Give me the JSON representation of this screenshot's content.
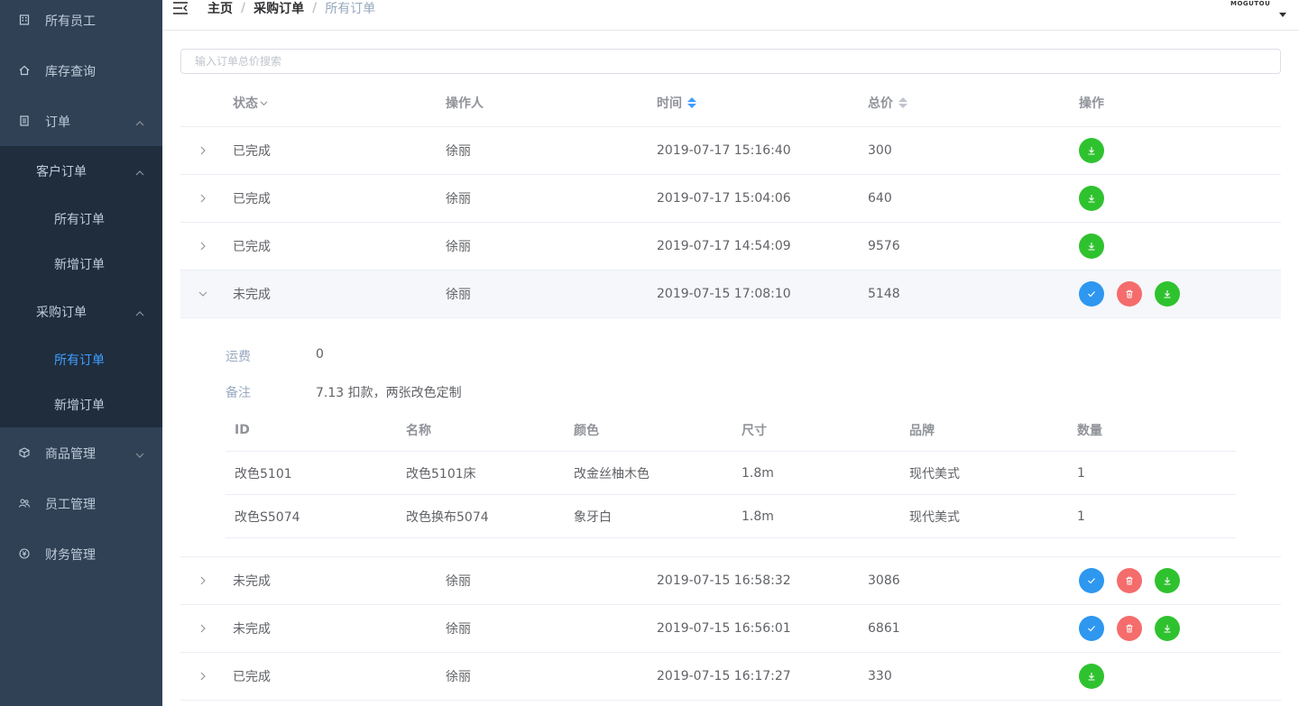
{
  "sidebar": {
    "items": [
      {
        "label": "所有员工",
        "icon": "building-icon"
      },
      {
        "label": "库存查询",
        "icon": "home-icon"
      },
      {
        "label": "订单",
        "icon": "document-icon",
        "expanded": true
      },
      {
        "label": "商品管理",
        "icon": "cube-icon",
        "expanded": false
      },
      {
        "label": "员工管理",
        "icon": "people-icon"
      },
      {
        "label": "财务管理",
        "icon": "money-icon"
      }
    ],
    "order_groups": [
      {
        "label": "客户订单",
        "children": [
          "所有订单",
          "新增订单"
        ]
      },
      {
        "label": "采购订单",
        "children": [
          "所有订单",
          "新增订单"
        ]
      }
    ],
    "active_item": "采购订单/所有订单"
  },
  "header": {
    "breadcrumb": [
      "主页",
      "采购订单",
      "所有订单"
    ],
    "separator": "/",
    "avatar_text": "MOGUTOU"
  },
  "search": {
    "placeholder": "输入订单总价搜索",
    "value": ""
  },
  "table": {
    "columns": [
      "状态",
      "操作人",
      "时间",
      "总价",
      "操作"
    ],
    "rows": [
      {
        "status": "已完成",
        "operator": "徐丽",
        "time": "2019-07-17 15:16:40",
        "total": "300",
        "actions": [
          "download"
        ]
      },
      {
        "status": "已完成",
        "operator": "徐丽",
        "time": "2019-07-17 15:04:06",
        "total": "640",
        "actions": [
          "download"
        ]
      },
      {
        "status": "已完成",
        "operator": "徐丽",
        "time": "2019-07-17 14:54:09",
        "total": "9576",
        "actions": [
          "download"
        ]
      },
      {
        "status": "未完成",
        "operator": "徐丽",
        "time": "2019-07-15 17:08:10",
        "total": "5148",
        "actions": [
          "confirm",
          "delete",
          "download"
        ],
        "expanded": true
      },
      {
        "status": "未完成",
        "operator": "徐丽",
        "time": "2019-07-15 16:58:32",
        "total": "3086",
        "actions": [
          "confirm",
          "delete",
          "download"
        ]
      },
      {
        "status": "未完成",
        "operator": "徐丽",
        "time": "2019-07-15 16:56:01",
        "total": "6861",
        "actions": [
          "confirm",
          "delete",
          "download"
        ]
      },
      {
        "status": "已完成",
        "operator": "徐丽",
        "time": "2019-07-15 16:17:27",
        "total": "330",
        "actions": [
          "download"
        ]
      }
    ]
  },
  "detail": {
    "freight_label": "运费",
    "freight_value": "0",
    "remark_label": "备注",
    "remark_value": "7.13 扣款，两张改色定制",
    "columns": [
      "ID",
      "名称",
      "颜色",
      "尺寸",
      "品牌",
      "数量"
    ],
    "items": [
      [
        "改色5101",
        "改色5101床",
        "改金丝柚木色",
        "1.8m",
        "现代美式",
        "1"
      ],
      [
        "改色S5074",
        "改色换布5074",
        "象牙白",
        "1.8m",
        "现代美式",
        "1"
      ]
    ]
  },
  "colors": {
    "sidebar_bg": "#304156",
    "submenu_bg": "#1f2d3d",
    "active": "#409eff",
    "success": "#2fc22f",
    "primary": "#2e97f0",
    "danger": "#f56c6c"
  }
}
